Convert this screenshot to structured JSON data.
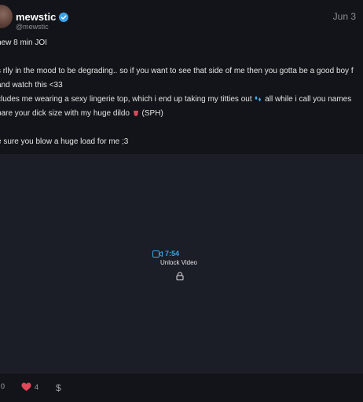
{
  "post": {
    "username": "mewstic",
    "handle": "@mewstic",
    "date": "Jun 3",
    "caption_lines": [
      "new 8 min JOI",
      "",
      "s rlly in the mood to be degrading.. so if you want to see that side of me then you gotta be a good boy f",
      "and watch this <33",
      "cludes me wearing a sexy lingerie top, which i end up taking my titties out",
      "all while i call you names",
      "pare your dick size with my huge dildo",
      "(SPH)",
      "e sure you blow a huge load for me ;3"
    ]
  },
  "media": {
    "duration": "7:54",
    "unlock_label": "Unlock Video"
  },
  "footer": {
    "comments_count": "0",
    "likes_count": "4",
    "tip_icon": "$"
  },
  "colors": {
    "accent": "#3ba4e8",
    "like": "#e0485a",
    "background": "#131419",
    "media_bg": "#1b1e27"
  }
}
